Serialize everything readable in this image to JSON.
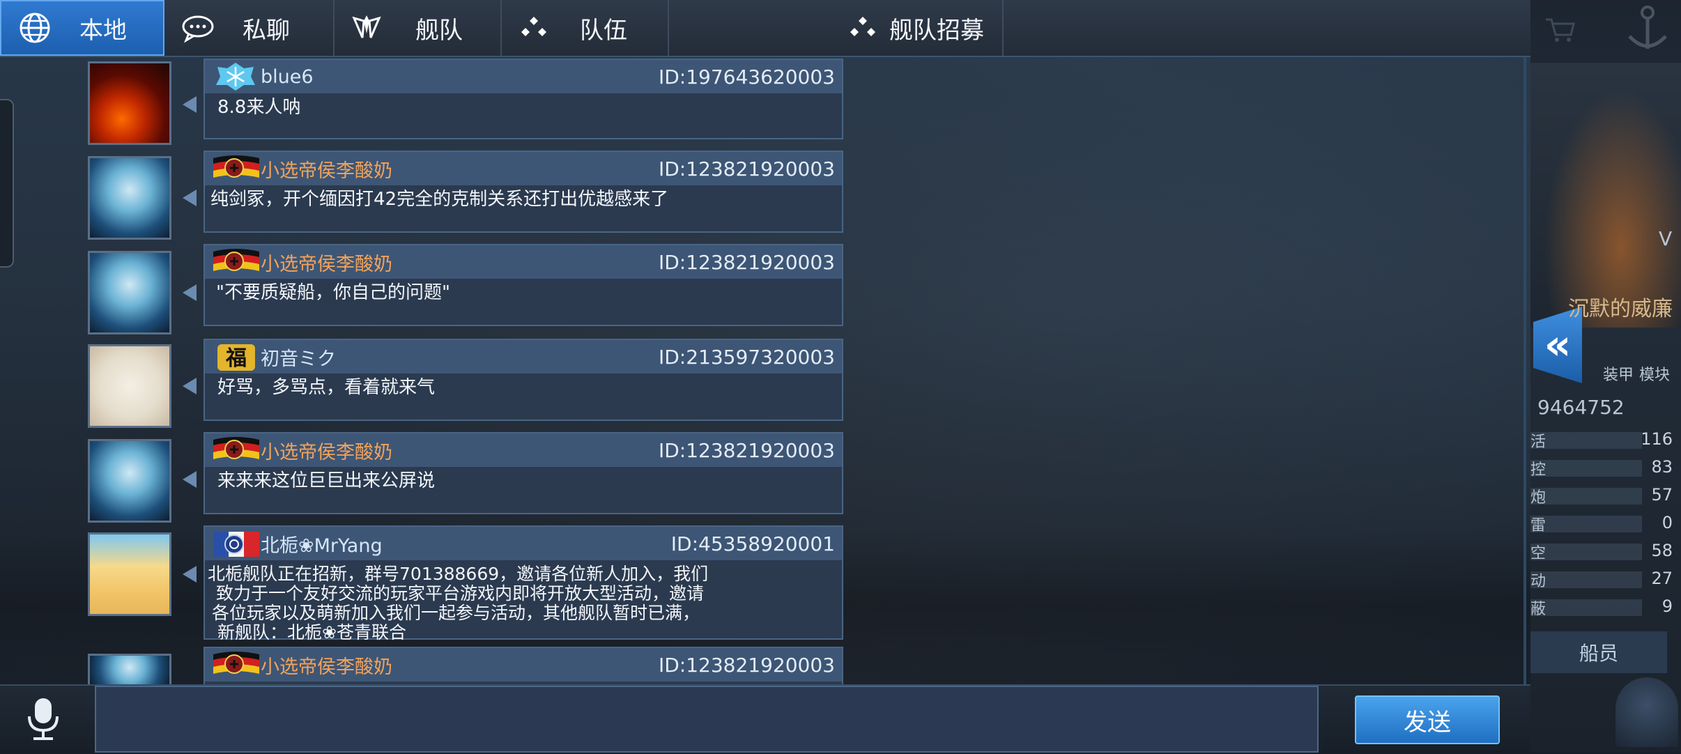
{
  "tabs": [
    {
      "label": "本地",
      "icon": "globe-icon",
      "active": true
    },
    {
      "label": "私聊",
      "icon": "chat-bubble-icon",
      "active": false
    },
    {
      "label": "舰队",
      "icon": "fleet-emblem-icon",
      "active": false
    },
    {
      "label": "队伍",
      "icon": "team-dots-icon",
      "active": false
    },
    {
      "label": "舰队招募",
      "icon": "team-dots-icon",
      "active": false
    }
  ],
  "messages": [
    {
      "name": "blue6",
      "badge": "snowflake-badge-icon",
      "id": "ID:197643620003",
      "text": [
        "8.8来人呐"
      ],
      "avatar": "fire-avatar"
    },
    {
      "name": "小选帝侯李酸奶",
      "badge": "german-flag-badge-icon",
      "id": "ID:123821920003",
      "text": [
        "纯剑冢，开个缅因打42完全的克制关系还打出优越感来了"
      ],
      "avatar": "blue-hair-girl-avatar"
    },
    {
      "name": "小选帝侯李酸奶",
      "badge": "german-flag-badge-icon",
      "id": "ID:123821920003",
      "text": [
        "\"不要质疑船，你自己的问题\""
      ],
      "avatar": "blue-hair-girl-avatar"
    },
    {
      "name": "初音ミク",
      "badge": "fu-character-badge-icon",
      "id": "ID:213597320003",
      "text": [
        "好骂，多骂点，看着就来气"
      ],
      "avatar": "miku-avatar"
    },
    {
      "name": "小选帝侯李酸奶",
      "badge": "german-flag-badge-icon",
      "id": "ID:123821920003",
      "text": [
        "来来来这位巨巨出来公屏说"
      ],
      "avatar": "blue-hair-girl-avatar"
    },
    {
      "name": "北栀❀MrYang",
      "badge": "french-flag-badge-icon",
      "id": "ID:45358920001",
      "text": [
        "北栀舰队正在招新，群号701388669，邀请各位新人加入，我们",
        "致力于一个友好交流的玩家平台游戏内即将开放大型活动，邀请",
        "各位玩家以及萌新加入我们一起参与活动，其他舰队暂时已满，",
        "新舰队：北栀❀苍青联合"
      ],
      "avatar": "blonde-girl-avatar"
    },
    {
      "name": "小选帝侯李酸奶",
      "badge": "german-flag-badge-icon",
      "id": "ID:123821920003",
      "text": [],
      "avatar": "blue-hair-girl-avatar"
    }
  ],
  "input": {
    "value": "",
    "placeholder": ""
  },
  "send_label": "发送",
  "right_panel": {
    "title_fragment": "沉默的威廉",
    "number": "9464752",
    "labels": [
      "装甲",
      "模块"
    ],
    "stats": [
      {
        "label": "活",
        "value": "116"
      },
      {
        "label": "控",
        "value": "83"
      },
      {
        "label": "炮",
        "value": "57"
      },
      {
        "label": "雷",
        "value": "0"
      },
      {
        "label": "空",
        "value": "58"
      },
      {
        "label": "动",
        "value": "27"
      },
      {
        "label": "蔽",
        "value": "9"
      }
    ],
    "crew_label": "船员",
    "v_mark": "V"
  },
  "colors": {
    "accent": "#2f7ad0",
    "name_orange": "#f2a35a",
    "bubble": "#2b3a4f"
  }
}
